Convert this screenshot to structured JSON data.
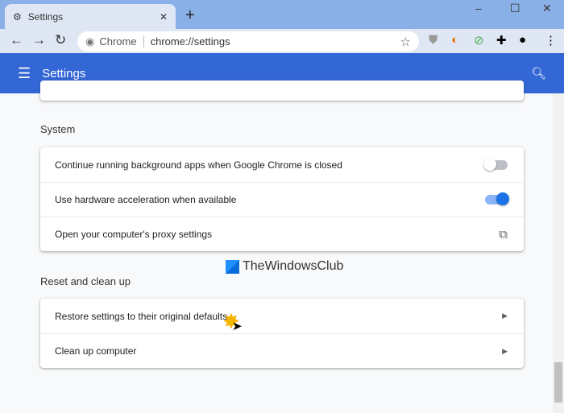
{
  "browser": {
    "tab_title": "Settings",
    "omnibox_label": "Chrome",
    "url": "chrome://settings"
  },
  "header": {
    "title": "Settings"
  },
  "sections": [
    {
      "title": "System",
      "rows": [
        {
          "label": "Continue running background apps when Google Chrome is closed",
          "control": "toggle",
          "on": false
        },
        {
          "label": "Use hardware acceleration when available",
          "control": "toggle",
          "on": true
        },
        {
          "label": "Open your computer's proxy settings",
          "control": "external-link-icon"
        }
      ]
    },
    {
      "title": "Reset and clean up",
      "rows": [
        {
          "label": "Restore settings to their original defaults",
          "control": "arrow-right-icon"
        },
        {
          "label": "Clean up computer",
          "control": "arrow-right-icon"
        }
      ]
    }
  ],
  "watermark": "TheWindowsClub",
  "colors": {
    "accent": "#3367d6",
    "toggle_on": "#1a73e8"
  }
}
